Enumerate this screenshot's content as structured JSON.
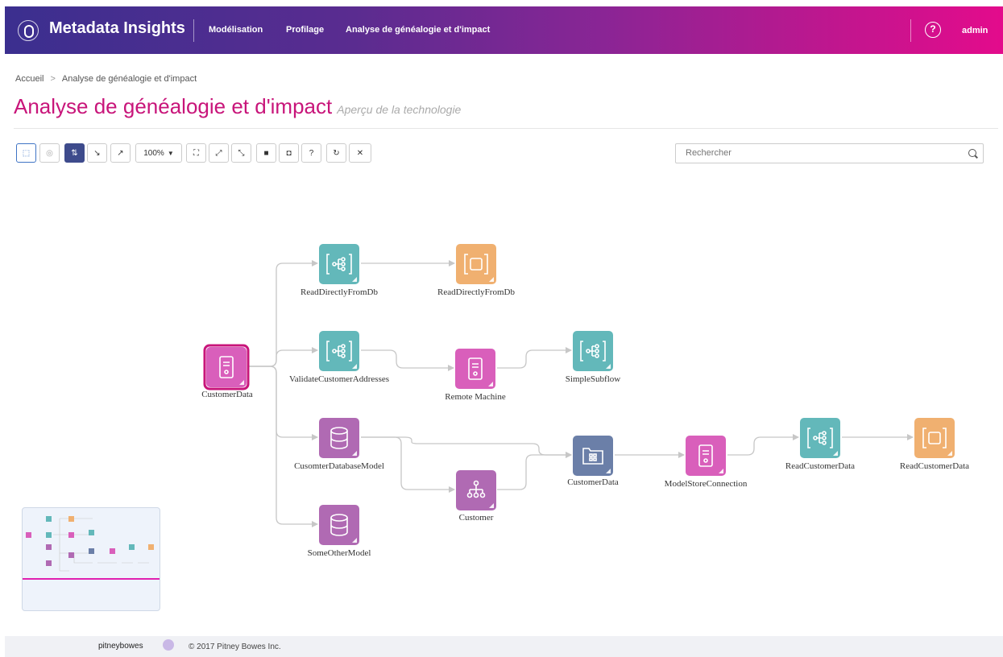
{
  "header": {
    "brand": "Metadata Insights",
    "nav": [
      "Modélisation",
      "Profilage",
      "Analyse de généalogie et d'impact"
    ],
    "help_label": "?",
    "user": "admin"
  },
  "breadcrumb": {
    "home": "Accueil",
    "current": "Analyse de généalogie et d'impact"
  },
  "page": {
    "title": "Analyse de généalogie et d'impact",
    "subtitle": "Aperçu de la technologie"
  },
  "toolbar": {
    "zoom": "100%",
    "help": "?",
    "search_placeholder": "Rechercher",
    "search_value": ""
  },
  "colors": {
    "flow": "#63b8ba",
    "output": "#f0b070",
    "model": "#b06ab3",
    "file": "#d95fbb",
    "folder": "#6b7fa8",
    "accent": "#c8157a"
  },
  "graph": {
    "nodes": [
      {
        "id": "n1",
        "label": "CustomerData",
        "type": "file",
        "selected": true
      },
      {
        "id": "n2",
        "label": "ReadDirectlyFromDb",
        "type": "flow"
      },
      {
        "id": "n3",
        "label": "ReadDirectlyFromDb",
        "type": "output"
      },
      {
        "id": "n4",
        "label": "ValidateCustomerAddresses",
        "type": "flow"
      },
      {
        "id": "n5",
        "label": "Remote Machine",
        "type": "file"
      },
      {
        "id": "n6",
        "label": "SimpleSubflow",
        "type": "flow"
      },
      {
        "id": "n7",
        "label": "CusomterDatabaseModel",
        "type": "model"
      },
      {
        "id": "n8",
        "label": "Customer",
        "type": "model"
      },
      {
        "id": "n9",
        "label": "CustomerData",
        "type": "folder"
      },
      {
        "id": "n10",
        "label": "ModelStoreConnection",
        "type": "file"
      },
      {
        "id": "n11",
        "label": "ReadCustomerData",
        "type": "flow"
      },
      {
        "id": "n12",
        "label": "ReadCustomerData",
        "type": "output"
      },
      {
        "id": "n13",
        "label": "SomeOtherModel",
        "type": "model"
      }
    ]
  },
  "footer": {
    "brand": "pitneybowes",
    "copyright": "© 2017 Pitney Bowes Inc."
  }
}
